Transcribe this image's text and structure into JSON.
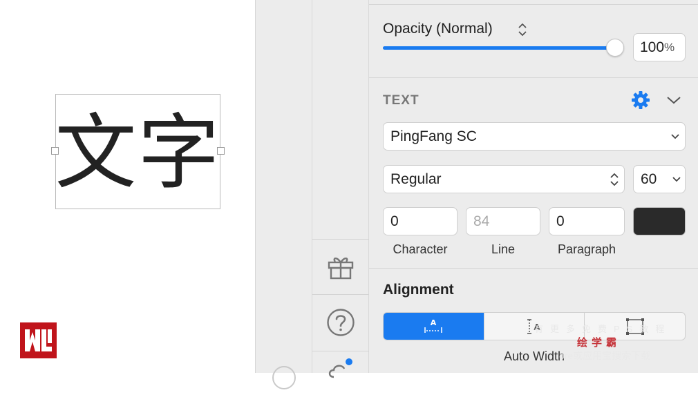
{
  "canvas": {
    "text_content": "文字"
  },
  "opacity": {
    "label": "Opacity (Normal)",
    "value": "100",
    "unit": "%",
    "level_percent": 100
  },
  "text_section": {
    "title": "TEXT",
    "font_family": "PingFang SC",
    "font_weight": "Regular",
    "font_size": "60",
    "character_spacing": "0",
    "line_height_placeholder": "84",
    "paragraph_spacing": "0",
    "color": "#2a2a2a",
    "labels": {
      "character": "Character",
      "line": "Line",
      "paragraph": "Paragraph"
    }
  },
  "alignment": {
    "title": "Alignment",
    "selected_label": "Auto Width"
  },
  "watermark": {
    "top": "有更多免费PS教程",
    "mid": "绘学霸",
    "bottom": "ore或应用宝搜索下载"
  },
  "colors": {
    "accent": "#1a7bf0",
    "panel_bg": "#ececec",
    "logo_red": "#c0141b"
  }
}
